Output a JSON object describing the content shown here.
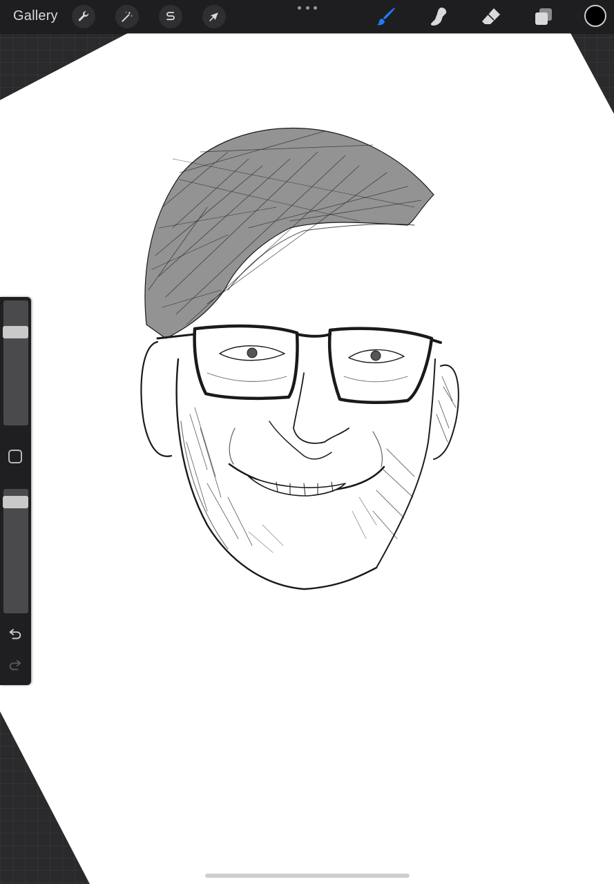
{
  "toolbar": {
    "gallery_label": "Gallery",
    "left_tools": [
      {
        "name": "actions",
        "icon": "wrench-icon"
      },
      {
        "name": "adjustments",
        "icon": "magic-wand-icon"
      },
      {
        "name": "selection",
        "icon": "selection-s-icon"
      },
      {
        "name": "transform",
        "icon": "arrow-cursor-icon"
      }
    ],
    "more_menu_icon": "ellipsis-icon",
    "right_tools": [
      {
        "name": "brush",
        "icon": "brush-icon",
        "active": true
      },
      {
        "name": "smudge",
        "icon": "smudge-icon",
        "active": false
      },
      {
        "name": "eraser",
        "icon": "eraser-icon",
        "active": false
      },
      {
        "name": "layers",
        "icon": "layers-icon",
        "active": false
      }
    ],
    "current_color": "#000000",
    "active_tool_color": "#1e7df5"
  },
  "sidebar": {
    "brush_size_slider": {
      "level": 0.77
    },
    "modifier_button_icon": "square-icon",
    "opacity_slider": {
      "level": 0.94
    },
    "undo_icon": "undo-icon",
    "redo_icon": "redo-icon",
    "redo_enabled": false
  },
  "canvas": {
    "paper_color": "#ffffff",
    "background_color": "#2a2a2d",
    "artwork": "pencil-sketch-portrait"
  }
}
